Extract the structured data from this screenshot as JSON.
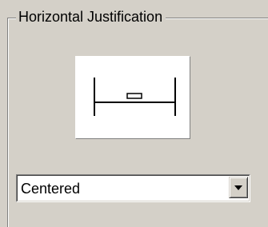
{
  "group": {
    "title": "Horizontal Justification"
  },
  "preview": {
    "icon": "horizontal-justification-centered-icon"
  },
  "dropdown": {
    "selected": "Centered",
    "button_icon": "chevron-down-icon"
  },
  "colors": {
    "face": "#d4d0c8",
    "shadow": "#808080",
    "highlight": "#ffffff",
    "text": "#000000"
  }
}
